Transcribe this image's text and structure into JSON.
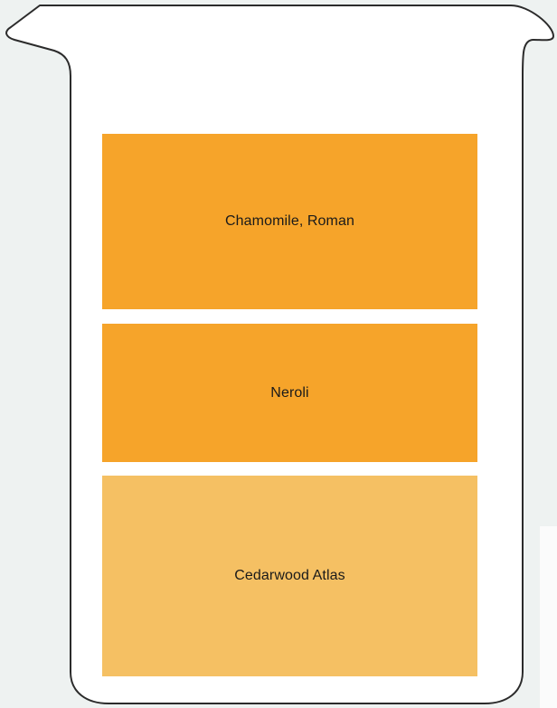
{
  "beaker": {
    "layers": [
      {
        "label": "Chamomile, Roman",
        "color": "#f6a42a"
      },
      {
        "label": "Neroli",
        "color": "#f6a42a"
      },
      {
        "label": "Cedarwood Atlas",
        "color": "#f5c063"
      }
    ]
  },
  "colors": {
    "background": "#eef2f1",
    "outline": "#2b2b2b",
    "beaker_fill": "#ffffff"
  }
}
